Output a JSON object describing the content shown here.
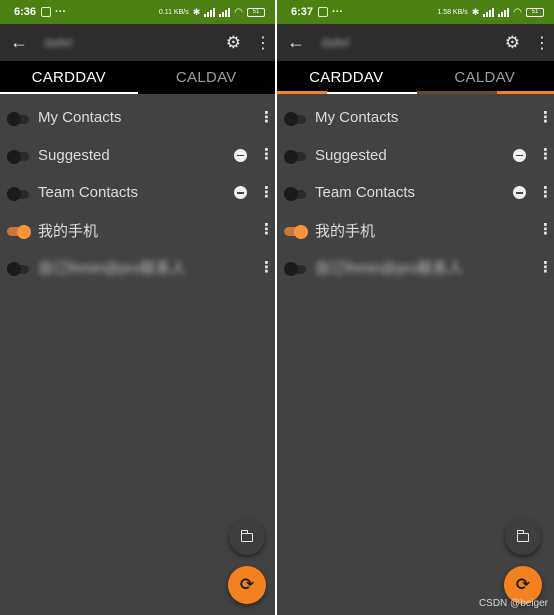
{
  "screens": [
    {
      "status": {
        "time": "6:36",
        "speed": "0.11 KB/s",
        "battery": "51"
      },
      "toolbar": {
        "back_icon": "arrow-back-icon",
        "account_title": "dafel",
        "settings_icon": "gear-icon",
        "more_icon": "more-vert-icon"
      },
      "tabs": [
        {
          "label": "CARDDAV",
          "active": true
        },
        {
          "label": "CALDAV",
          "active": false
        }
      ],
      "addressbooks": [
        {
          "label": "My Contacts",
          "enabled": false,
          "removable": false,
          "blurred": false
        },
        {
          "label": "Suggested",
          "enabled": false,
          "removable": true,
          "blurred": false
        },
        {
          "label": "Team Contacts",
          "enabled": false,
          "removable": true,
          "blurred": false
        },
        {
          "label": "我的手机",
          "enabled": true,
          "removable": false,
          "blurred": false
        },
        {
          "label": "自订lhmin@pro联系人",
          "enabled": false,
          "removable": false,
          "blurred": true
        }
      ],
      "fab_small_icon": "folder-sync-icon",
      "fab_big_icon": "sync-icon"
    },
    {
      "status": {
        "time": "6:37",
        "speed": "1.58 KB/s",
        "battery": "51"
      },
      "toolbar": {
        "back_icon": "arrow-back-icon",
        "account_title": "dafel",
        "settings_icon": "gear-icon",
        "more_icon": "more-vert-icon"
      },
      "tabs": [
        {
          "label": "CARDDAV",
          "active": true
        },
        {
          "label": "CALDAV",
          "active": false
        }
      ],
      "addressbooks": [
        {
          "label": "My Contacts",
          "enabled": false,
          "removable": false,
          "blurred": false
        },
        {
          "label": "Suggested",
          "enabled": false,
          "removable": true,
          "blurred": false
        },
        {
          "label": "Team Contacts",
          "enabled": false,
          "removable": true,
          "blurred": false
        },
        {
          "label": "我的手机",
          "enabled": true,
          "removable": false,
          "blurred": false
        },
        {
          "label": "自订lhmin@pro联系人",
          "enabled": false,
          "removable": false,
          "blurred": true
        }
      ],
      "syncing": true,
      "fab_small_icon": "folder-sync-icon",
      "fab_big_icon": "sync-icon"
    }
  ],
  "watermark": "CSDN @beiger",
  "colors": {
    "accent": "#f4811f",
    "statusbar": "#4b8012",
    "background": "#424242",
    "toolbar": "#2d2d2d"
  }
}
